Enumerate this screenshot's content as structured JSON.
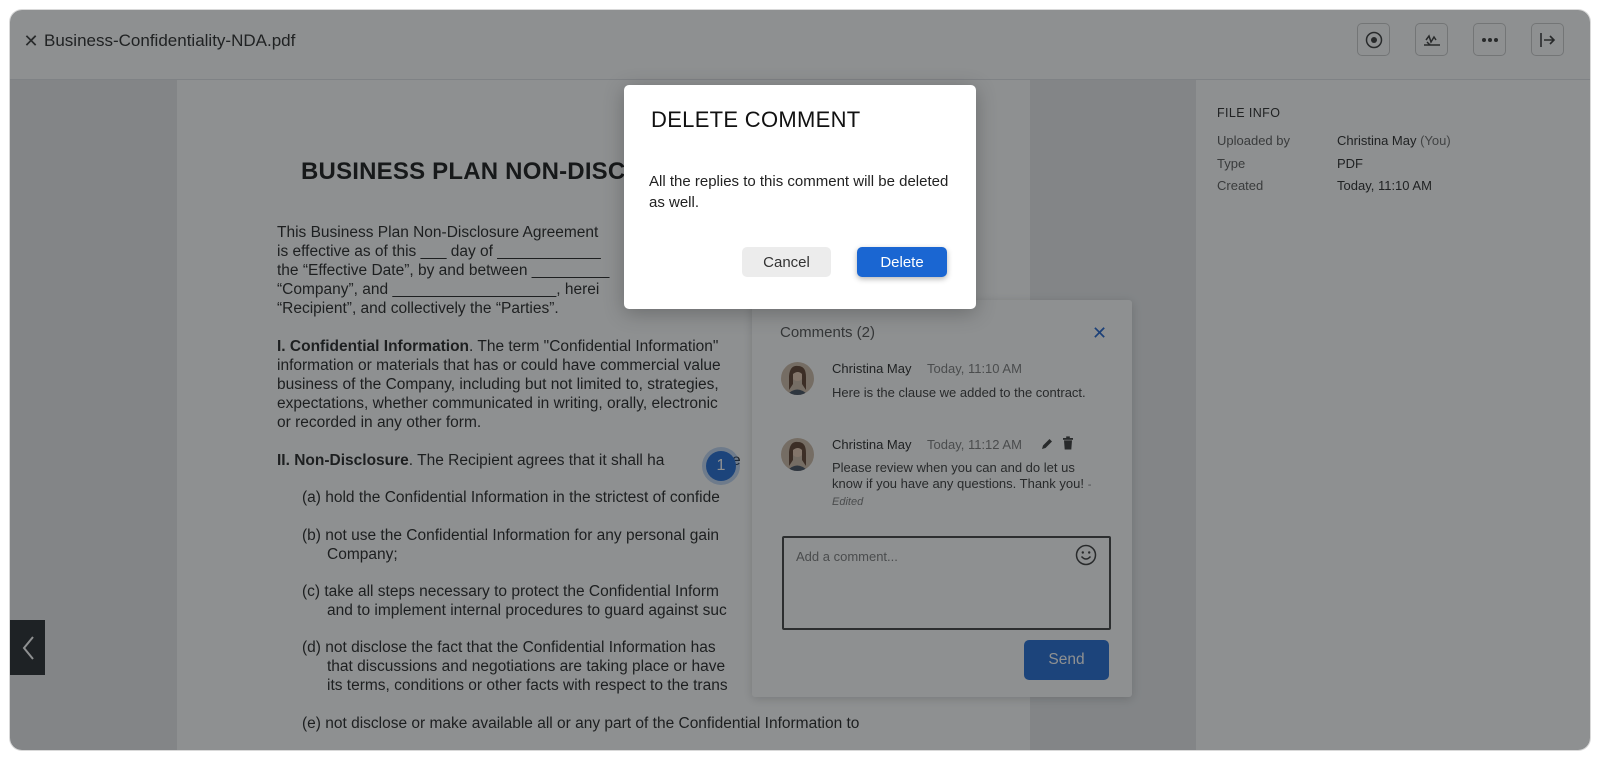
{
  "header": {
    "close_label": "✕",
    "filename": "Business-Confidentiality-NDA.pdf",
    "buttons": [
      "record-icon",
      "sign-icon",
      "more-icon",
      "exit-panel-icon"
    ]
  },
  "document": {
    "title": "BUSINESS PLAN NON-DISC",
    "intro": [
      "This Business Plan Non-Disclosure Agreement",
      "is effective as of this ___ day of ____________",
      "the “Effective Date”, by and between _________",
      "“Company”, and ___________________, herei",
      "“Recipient”, and collectively the “Parties”."
    ],
    "section1_heading": "I. Confidential Information",
    "section1_lines": [
      ". The term \"Confidential Information\"",
      "information or materials that has or could have commercial value",
      "business of the Company, including but not limited to, strategies,",
      "expectations, whether communicated in writing, orally, electronic",
      "or recorded in any other form."
    ],
    "section2_heading": "II. Non-Disclosure",
    "section2_text": ". The Recipient agrees that it shall ha",
    "section2_tail": "e",
    "items": [
      {
        "a": "(a) hold the Confidential Information in the strictest of confide"
      },
      {
        "b1": "(b) not use the Confidential Information for any personal gain",
        "b2": "Company;"
      },
      {
        "c1": "(c) take all steps necessary to protect the Confidential Inform",
        "c2": "and to implement internal procedures to guard against suc"
      },
      {
        "d1": "(d) not disclose the fact that the Confidential Information has",
        "d2": "that discussions and negotiations are taking place or have",
        "d3": "its terms, conditions or other facts with respect to the trans"
      },
      {
        "e1": "(e) not disclose or make available all or any part of the Confidential Information to"
      }
    ],
    "marker_number": "1"
  },
  "file_info": {
    "title": "FILE INFO",
    "uploaded_by_label": "Uploaded by",
    "uploaded_by_name": "Christina May",
    "uploaded_by_you": "(You)",
    "type_label": "Type",
    "type_value": "PDF",
    "created_label": "Created",
    "created_value": "Today, 11:10 AM"
  },
  "comments": {
    "title": "Comments (2)",
    "close": "✕",
    "items": [
      {
        "name": "Christina May",
        "time": "Today, 11:10 AM",
        "text": "Here is the clause we added to the contract."
      },
      {
        "name": "Christina May",
        "time": "Today, 11:12 AM",
        "text": "Please review when you can and do let us know if you have any questions. Thank you!",
        "edited": "-Edited"
      }
    ],
    "input_placeholder": "Add a comment...",
    "send_label": "Send"
  },
  "modal": {
    "title": "DELETE COMMENT",
    "body": "All the replies to this comment will be deleted as well.",
    "cancel_label": "Cancel",
    "delete_label": "Delete"
  },
  "colors": {
    "accent": "#1a66d2",
    "overlay": "rgba(30,33,36,0.5)"
  }
}
